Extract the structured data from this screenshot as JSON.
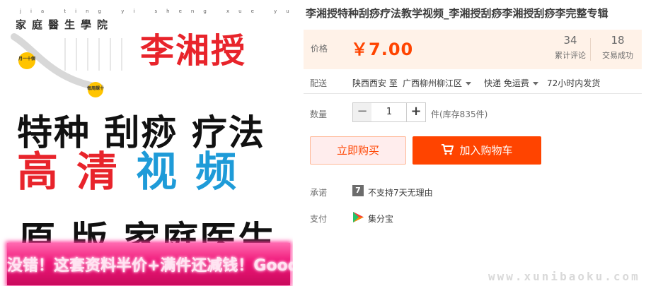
{
  "product_image": {
    "logo_pinyin": "jia ting yi sheng xue yuan",
    "logo_title": "家庭醫生學院",
    "badge_left": "月一十個",
    "badge_right": "每周課十",
    "author_name": "李湘授",
    "line_black": "特种 刮痧  疗法",
    "line_hd_red_1": "高",
    "line_hd_red_2": "清",
    "line_hd_blue_1": "视",
    "line_hd_blue_2": "频",
    "line_original": "原 版  家庭医生",
    "promo_banner": "没错！这套资料半价+满件还减钱！Good!"
  },
  "product": {
    "title": "李湘授特种刮痧疗法教学视频_李湘授刮痧李湘授刮痧李完整专辑",
    "price_label": "价格",
    "price": "￥7.00",
    "review_count": "34",
    "review_label": "累计评论",
    "sales_count": "18",
    "sales_label": "交易成功"
  },
  "shipping": {
    "label": "配送",
    "from": "陕西西安 至",
    "to": "广西柳州柳江区",
    "method": "快递 免运费",
    "dispatch": "72小时内发货"
  },
  "quantity": {
    "label": "数量",
    "minus": "−",
    "value": "1",
    "plus": "+",
    "stock": "件(库存835件)"
  },
  "actions": {
    "buy_now": "立即购买",
    "add_to_cart": "加入购物车"
  },
  "promise": {
    "label": "承诺",
    "icon_glyph": "7",
    "text": "不支持7天无理由"
  },
  "payment": {
    "label": "支付",
    "method": "集分宝"
  },
  "watermark": "www.xunibaoku.com",
  "colors": {
    "accent": "#ff4400",
    "price_bg": "#fff2e8",
    "buy_now_bg": "#ffeded",
    "image_red": "#e8242b",
    "image_blue": "#1e9bd8",
    "banner_pink": "#f01678"
  }
}
